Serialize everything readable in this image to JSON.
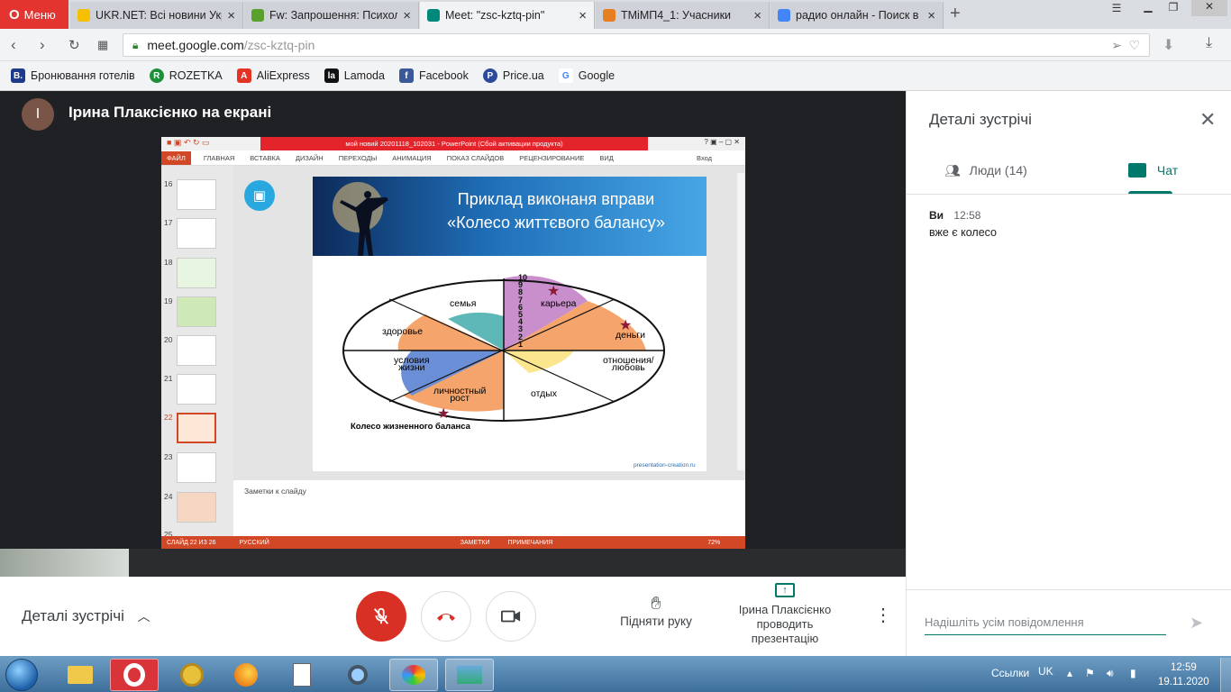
{
  "browser": {
    "menu_label": "Меню",
    "tabs": [
      {
        "label": "UKR.NET: Всі новини Укра",
        "color": "#f6c000"
      },
      {
        "label": "Fw: Запрошення: Психолс",
        "color": "#5aa02c"
      },
      {
        "label": "Meet: \"zsc-kztq-pin\"",
        "color": "#00897b"
      },
      {
        "label": "ТМіМП4_1: Учасники",
        "color": "#e67e22"
      },
      {
        "label": "радио онлайн - Поиск в G",
        "color": "#4285f4"
      }
    ],
    "add_tab": "+",
    "url_host": "meet.google.com",
    "url_path": "/zsc-kztq-pin",
    "bookmarks": [
      {
        "label": "Бронювання готелів",
        "badge": "B.",
        "color": "#1e3a8a"
      },
      {
        "label": "ROZETKA",
        "badge": "R",
        "color": "#1e8f3a"
      },
      {
        "label": "AliExpress",
        "badge": "A",
        "color": "#e43225"
      },
      {
        "label": "Lamoda",
        "badge": "la",
        "color": "#111111"
      },
      {
        "label": "Facebook",
        "badge": "f",
        "color": "#3b5998"
      },
      {
        "label": "Price.ua",
        "badge": "P",
        "color": "#2c4b9a"
      },
      {
        "label": "Google",
        "badge": "G",
        "color": "#4285f4"
      }
    ]
  },
  "meet": {
    "presenter_initial": "І",
    "presenter_label": "Ірина Плаксієнко на екрані",
    "details_label": "Деталі зустрічі",
    "raise_hand": "Підняти руку",
    "presenting_label": "Ірина Плаксієнко проводить презентацію",
    "side": {
      "title": "Деталі зустрічі",
      "people_tab": "Люди (14)",
      "chat_tab": "Чат",
      "messages": [
        {
          "author": "Ви",
          "time": "12:58",
          "text": "вже є колесо"
        }
      ],
      "input_placeholder": "Надішліть усім повідомлення"
    }
  },
  "ppt": {
    "title": "мой новий 20201118_102031 - PowerPoint (Сбой активации продукта)",
    "ribbon": [
      "ФАЙЛ",
      "ГЛАВНАЯ",
      "ВСТАВКА",
      "ДИЗАЙН",
      "ПЕРЕХОДЫ",
      "АНИМАЦИЯ",
      "ПОКАЗ СЛАЙДОВ",
      "РЕЦЕНЗИРОВАНИЕ",
      "ВИД"
    ],
    "login": "Вход",
    "thumb_numbers": [
      "16",
      "17",
      "18",
      "19",
      "20",
      "21",
      "22",
      "23",
      "24",
      "25"
    ],
    "selected_thumb": "22",
    "slide_title_1": "Приклад виконаня вправи",
    "slide_title_2": "«Колесо життєвого балансу»",
    "wheel_labels": {
      "semya": "семья",
      "kariera": "карьера",
      "zdorove": "здоровье",
      "dengi": "деньги",
      "usloviya1": "условия",
      "usloviya2": "жизни",
      "otnosheniya1": "отношения/",
      "otnosheniya2": "любовь",
      "lichnostny1": "личностный",
      "lichnostny2": "рост",
      "otdyh": "отдых",
      "caption": "Колесо жизненного баланса"
    },
    "scale": [
      "10",
      "9",
      "8",
      "7",
      "6",
      "5",
      "4",
      "3",
      "2",
      "1"
    ],
    "source": "presentation-creation.ru",
    "notes_placeholder": "Заметки к слайду",
    "status_slide": "СЛАЙД 22 ИЗ 26",
    "status_lang": "РУССКИЙ",
    "status_notes": "ЗАМЕТКИ",
    "status_comments": "ПРИМЕЧАНИЯ",
    "zoom": "72%"
  },
  "taskbar": {
    "links": "Ссылки",
    "lang": "UK",
    "time": "12:59",
    "date": "19.11.2020"
  }
}
